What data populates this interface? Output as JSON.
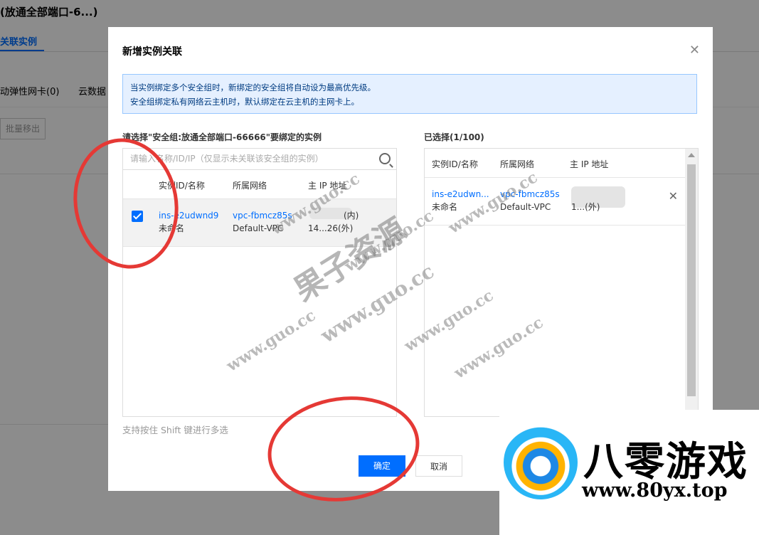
{
  "background": {
    "title": "(放通全部端口-6...)",
    "tab": "关联实例",
    "subtabs": [
      "动弹性网卡(0)",
      "云数据"
    ],
    "batch_remove": "批量移出"
  },
  "dialog": {
    "title": "新增实例关联",
    "close_icon": "close-icon",
    "notice": [
      "当实例绑定多个安全组时，新绑定的安全组将自动设为最高优先级。",
      "安全组绑定私有网络云主机时，默认绑定在云主机的主网卡上。"
    ],
    "left_label": "请选择\"安全组:放通全部端口-66666\"要绑定的实例",
    "search_placeholder": "请输入名称/ID/IP（仅显示未关联该安全组的实例）",
    "columns": [
      "实例ID/名称",
      "所属网络",
      "主 IP 地址"
    ],
    "left_rows": [
      {
        "id": "ins-e2udwnd9",
        "name": "未命名",
        "vpc": "vpc-fbmcz85s",
        "network": "Default-VPC",
        "ip1": "(内)",
        "ip2": "14...26(外)",
        "checked": true
      }
    ],
    "right_label": "已选择(1/100)",
    "right_rows": [
      {
        "id": "ins-e2udwn...",
        "name": "未命名",
        "vpc": "vpc-fbmcz85s",
        "network": "Default-VPC",
        "ip2": "1...(外)"
      }
    ],
    "tip": "支持按住 Shift 键进行多选",
    "ok": "确定",
    "cancel": "取消"
  },
  "watermarks": {
    "small": "www.guo.cc",
    "big": "果子资源"
  },
  "logo": {
    "text": "八零游戏",
    "url": "www.80yx.top"
  },
  "colors": {
    "accent": "#006eff",
    "annotation": "#e53935"
  }
}
